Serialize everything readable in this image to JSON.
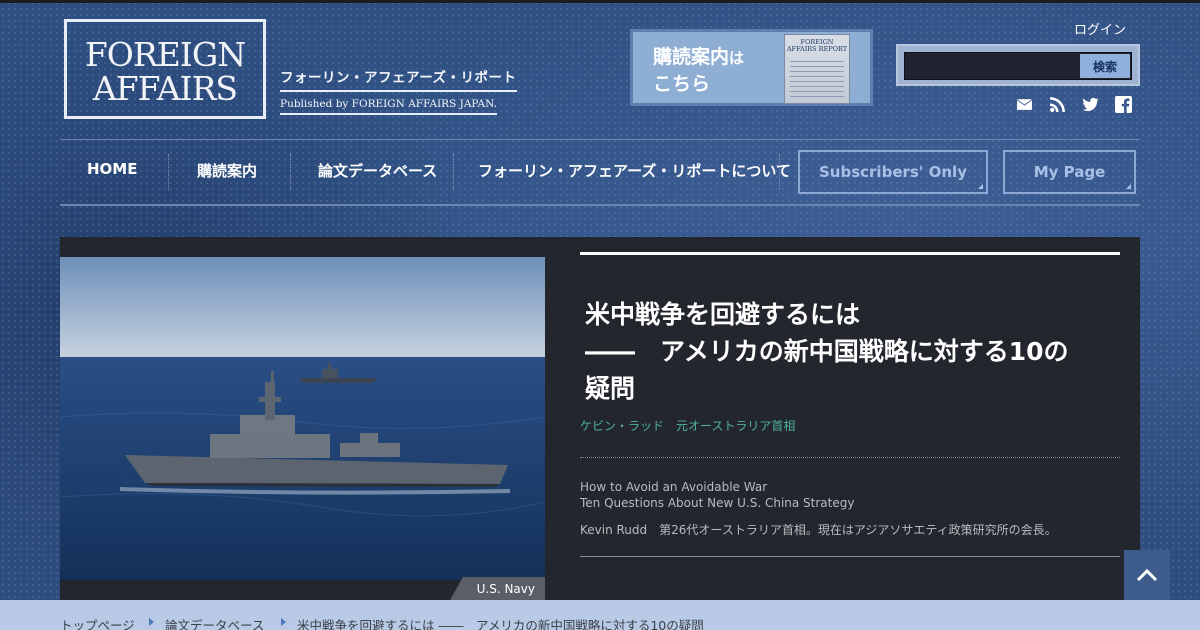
{
  "brand": {
    "logo_line1": "FOREIGN",
    "logo_line2": "AFFAIRS",
    "jp_title": "フォーリン・アフェアーズ・リポート",
    "published_by": "Published by FOREIGN AFFAIRS JAPAN."
  },
  "banner": {
    "line1_main": "購読案内",
    "line1_small": "は",
    "line2": "こちら",
    "book_title": "FOREIGN AFFAIRS REPORT"
  },
  "header": {
    "login_label": "ログイン",
    "search_placeholder": "",
    "search_button": "検索",
    "icons": [
      "mail-icon",
      "rss-icon",
      "twitter-icon",
      "facebook-icon"
    ]
  },
  "nav": {
    "items": [
      {
        "label": "HOME"
      },
      {
        "label": "購読案内"
      },
      {
        "label": "論文データベース"
      },
      {
        "label": "フォーリン・アフェアーズ・リポートについて"
      }
    ],
    "subscribers_only": "Subscribers' Only",
    "my_page": "My Page"
  },
  "feature": {
    "headline_line1": "米中戦争を回避するには",
    "headline_line2": "――　アメリカの新中国戦略に対する10の",
    "headline_line3": "疑問",
    "author_jp": "ケビン・ラッド　元オーストラリア首相",
    "title_en_1": "How to Avoid an Avoidable War",
    "title_en_2": "Ten Questions About New U.S. China Strategy",
    "author_en": "Kevin Rudd　第26代オーストラリア首相。現在はアジアソサエティ政策研究所の会長。",
    "photo_credit": "U.S. Navy"
  },
  "breadcrumb": [
    {
      "label": "トップページ"
    },
    {
      "label": "論文データベース"
    },
    {
      "label": "米中戦争を回避するには ――　アメリカの新中国戦略に対する10の疑問"
    }
  ],
  "colors": {
    "background": "#2f4f82",
    "feature_panel": "#23262d",
    "author_accent": "#4fb39a",
    "breadcrumb_bg": "#b8cae6"
  }
}
